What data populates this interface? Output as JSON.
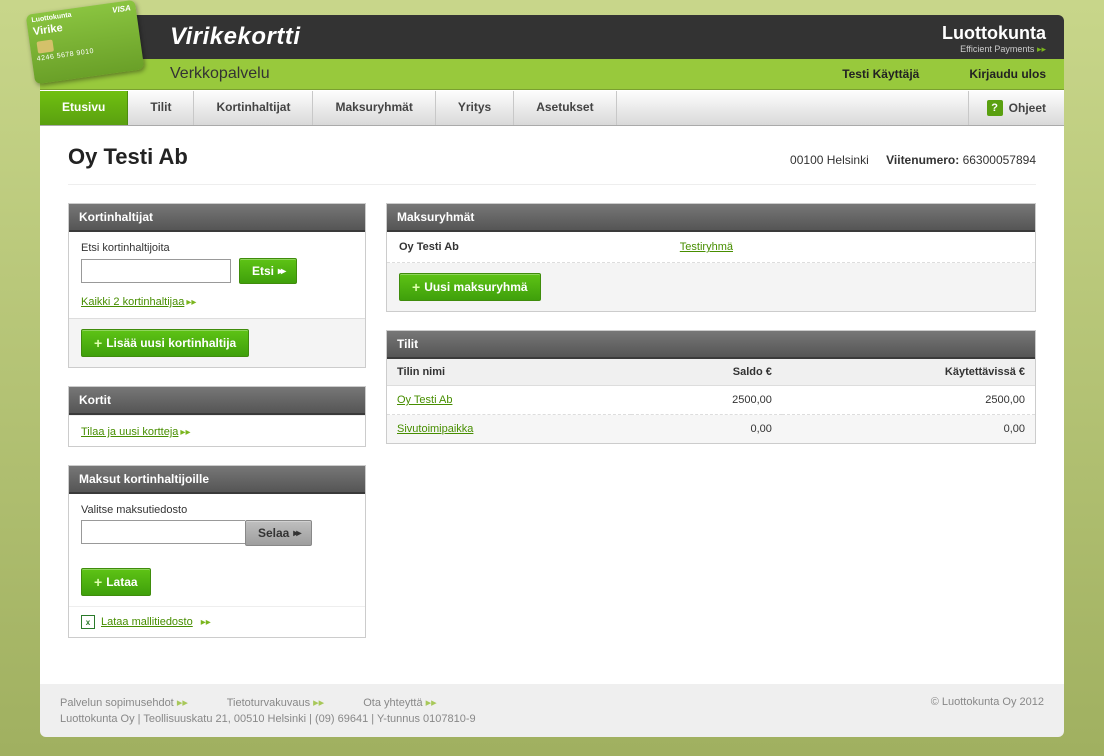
{
  "brand": {
    "title": "Virikekortti",
    "subtitle": "Verkkopalvelu",
    "card_brand": "Luottokunta",
    "card_name": "Virike",
    "card_visa": "VISA",
    "card_num": "4246 5678 9010",
    "logo_line1": "Luottokunta",
    "logo_line2": "Efficient Payments"
  },
  "userbar": {
    "username": "Testi Käyttäjä",
    "logout": "Kirjaudu ulos"
  },
  "nav": {
    "home": "Etusivu",
    "accounts": "Tilit",
    "cardholders": "Kortinhaltijat",
    "paygroups": "Maksuryhmät",
    "company": "Yritys",
    "settings": "Asetukset",
    "help": "Ohjeet"
  },
  "page": {
    "title": "Oy Testi Ab",
    "city": "00100 Helsinki",
    "ref_label": "Viitenumero:",
    "ref_value": "66300057894"
  },
  "cardholders_panel": {
    "title": "Kortinhaltijat",
    "search_label": "Etsi kortinhaltijoita",
    "search_btn": "Etsi",
    "all_link": "Kaikki 2 kortinhaltijaa",
    "add_btn": "Lisää uusi kortinhaltija"
  },
  "cards_panel": {
    "title": "Kortit",
    "order_link": "Tilaa ja uusi kortteja"
  },
  "payments_panel": {
    "title": "Maksut kortinhaltijoille",
    "file_label": "Valitse maksutiedosto",
    "browse_btn": "Selaa",
    "upload_btn": "Lataa",
    "template_link": "Lataa mallitiedosto"
  },
  "groups_panel": {
    "title": "Maksuryhmät",
    "rows": [
      {
        "name": "Oy Testi Ab",
        "link": "Testiryhmä"
      }
    ],
    "add_btn": "Uusi maksuryhmä"
  },
  "accounts_panel": {
    "title": "Tilit",
    "col_name": "Tilin nimi",
    "col_balance": "Saldo €",
    "col_avail": "Käytettävissä €",
    "rows": [
      {
        "name": "Oy Testi Ab",
        "balance": "2500,00",
        "avail": "2500,00"
      },
      {
        "name": "Sivutoimipaikka",
        "balance": "0,00",
        "avail": "0,00"
      }
    ]
  },
  "footer": {
    "links": {
      "terms": "Palvelun sopimusehdot",
      "security": "Tietoturvakuvaus",
      "contact": "Ota yhteyttä"
    },
    "address": "Luottokunta Oy | Teollisuuskatu 21, 00510 Helsinki | (09) 69641 | Y-tunnus 0107810-9",
    "copyright": "© Luottokunta Oy 2012"
  }
}
